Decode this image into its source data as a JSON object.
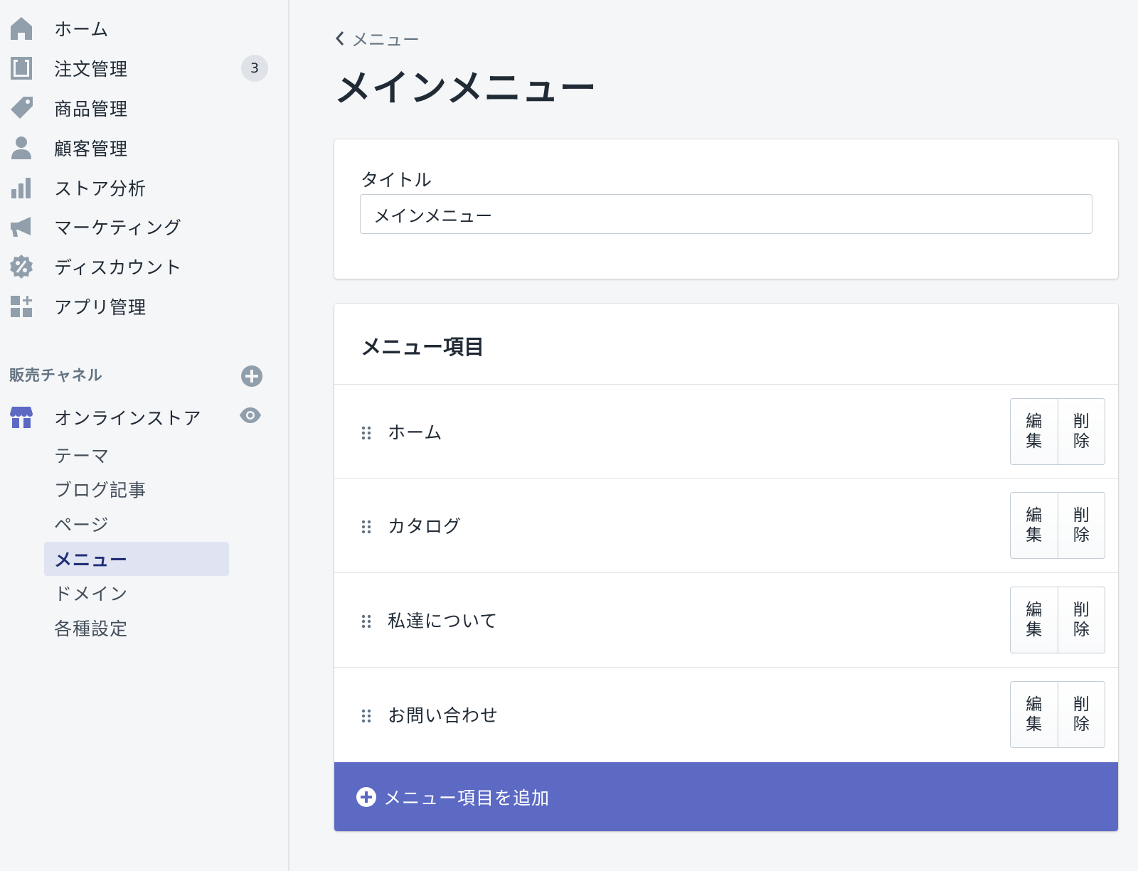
{
  "sidebar": {
    "nav": [
      {
        "label": "ホーム",
        "icon": "home-icon"
      },
      {
        "label": "注文管理",
        "icon": "orders-icon",
        "badge": "3"
      },
      {
        "label": "商品管理",
        "icon": "tag-icon"
      },
      {
        "label": "顧客管理",
        "icon": "person-icon"
      },
      {
        "label": "ストア分析",
        "icon": "bar-chart-icon"
      },
      {
        "label": "マーケティング",
        "icon": "megaphone-icon"
      },
      {
        "label": "ディスカウント",
        "icon": "discount-icon"
      },
      {
        "label": "アプリ管理",
        "icon": "apps-icon"
      }
    ],
    "sales_channels": {
      "heading": "販売チャネル",
      "store": {
        "label": "オンラインストア",
        "icon": "store-icon"
      },
      "sub_items": [
        {
          "label": "テーマ"
        },
        {
          "label": "ブログ記事"
        },
        {
          "label": "ページ"
        },
        {
          "label": "メニュー",
          "active": true
        },
        {
          "label": "ドメイン"
        },
        {
          "label": "各種設定"
        }
      ]
    }
  },
  "main": {
    "breadcrumb": "メニュー",
    "page_title": "メインメニュー",
    "title_card": {
      "label": "タイトル",
      "value": "メインメニュー"
    },
    "items_card": {
      "heading": "メニュー項目",
      "items": [
        {
          "label": "ホーム"
        },
        {
          "label": "カタログ"
        },
        {
          "label": "私達について"
        },
        {
          "label": "お問い合わせ"
        }
      ],
      "edit_label": "編集",
      "delete_label": "削除",
      "add_label": "メニュー項目を追加"
    }
  },
  "colors": {
    "accent": "#5c6ac4",
    "active_bg": "#e0e4f2",
    "active_text": "#202e78",
    "icon_gray": "#919eab"
  }
}
